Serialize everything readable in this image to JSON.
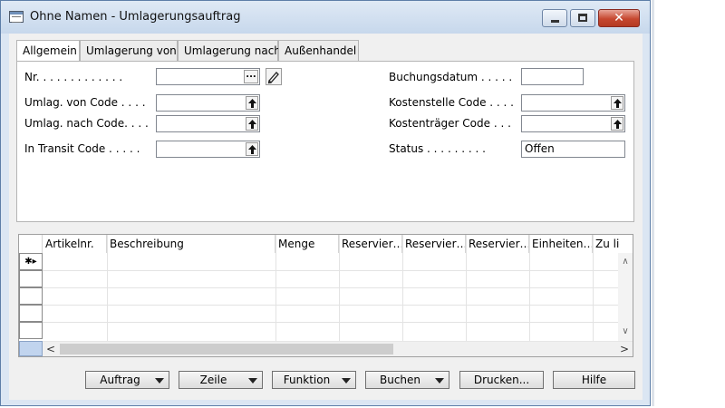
{
  "window": {
    "title": "Ohne Namen - Umlagerungsauftrag",
    "close_glyph": "✕",
    "accent": "#c6472f"
  },
  "tabs": [
    {
      "label": "Allgemein",
      "active": true
    },
    {
      "label": "Umlagerung von",
      "active": false
    },
    {
      "label": "Umlagerung nach",
      "active": false
    },
    {
      "label": "Außenhandel",
      "active": false
    }
  ],
  "fields": {
    "nr": {
      "label": "Nr. . . . . . . . . . . . .",
      "value": "",
      "assist": "...",
      "icon": "pencil-icon"
    },
    "from_code": {
      "label": "Umlag. von Code . . . .",
      "value": "",
      "icon": "lookup-arrow-icon"
    },
    "to_code": {
      "label": "Umlag. nach Code. . . .",
      "value": "",
      "icon": "lookup-arrow-icon"
    },
    "transit": {
      "label": "In Transit Code . . . . .",
      "value": "",
      "icon": "lookup-arrow-icon"
    },
    "posting_date": {
      "label": "Buchungsdatum . . . . .",
      "value": ""
    },
    "cost_center": {
      "label": "Kostenstelle Code . . . .",
      "value": "",
      "icon": "lookup-arrow-icon"
    },
    "cost_object": {
      "label": "Kostenträger Code . . .",
      "value": "",
      "icon": "lookup-arrow-icon"
    },
    "status": {
      "label": "Status . . . . . . . . .",
      "value": "Offen"
    }
  },
  "grid": {
    "columns": [
      "Artikelnr.",
      "Beschreibung",
      "Menge",
      "Reservier…",
      "Reservier…",
      "Reservier…",
      "Einheiten…",
      "Zu lie"
    ],
    "new_row_marker": "✱▸",
    "scroll_left": "<",
    "scroll_right": ">",
    "scroll_up": "∧",
    "scroll_down": "∨"
  },
  "buttons": [
    {
      "label": "Auftrag",
      "menu": true
    },
    {
      "label": "Zeile",
      "menu": true
    },
    {
      "label": "Funktion",
      "menu": true
    },
    {
      "label": "Buchen",
      "menu": true
    },
    {
      "label": "Drucken...",
      "menu": false
    },
    {
      "label": "Hilfe",
      "menu": false
    }
  ]
}
